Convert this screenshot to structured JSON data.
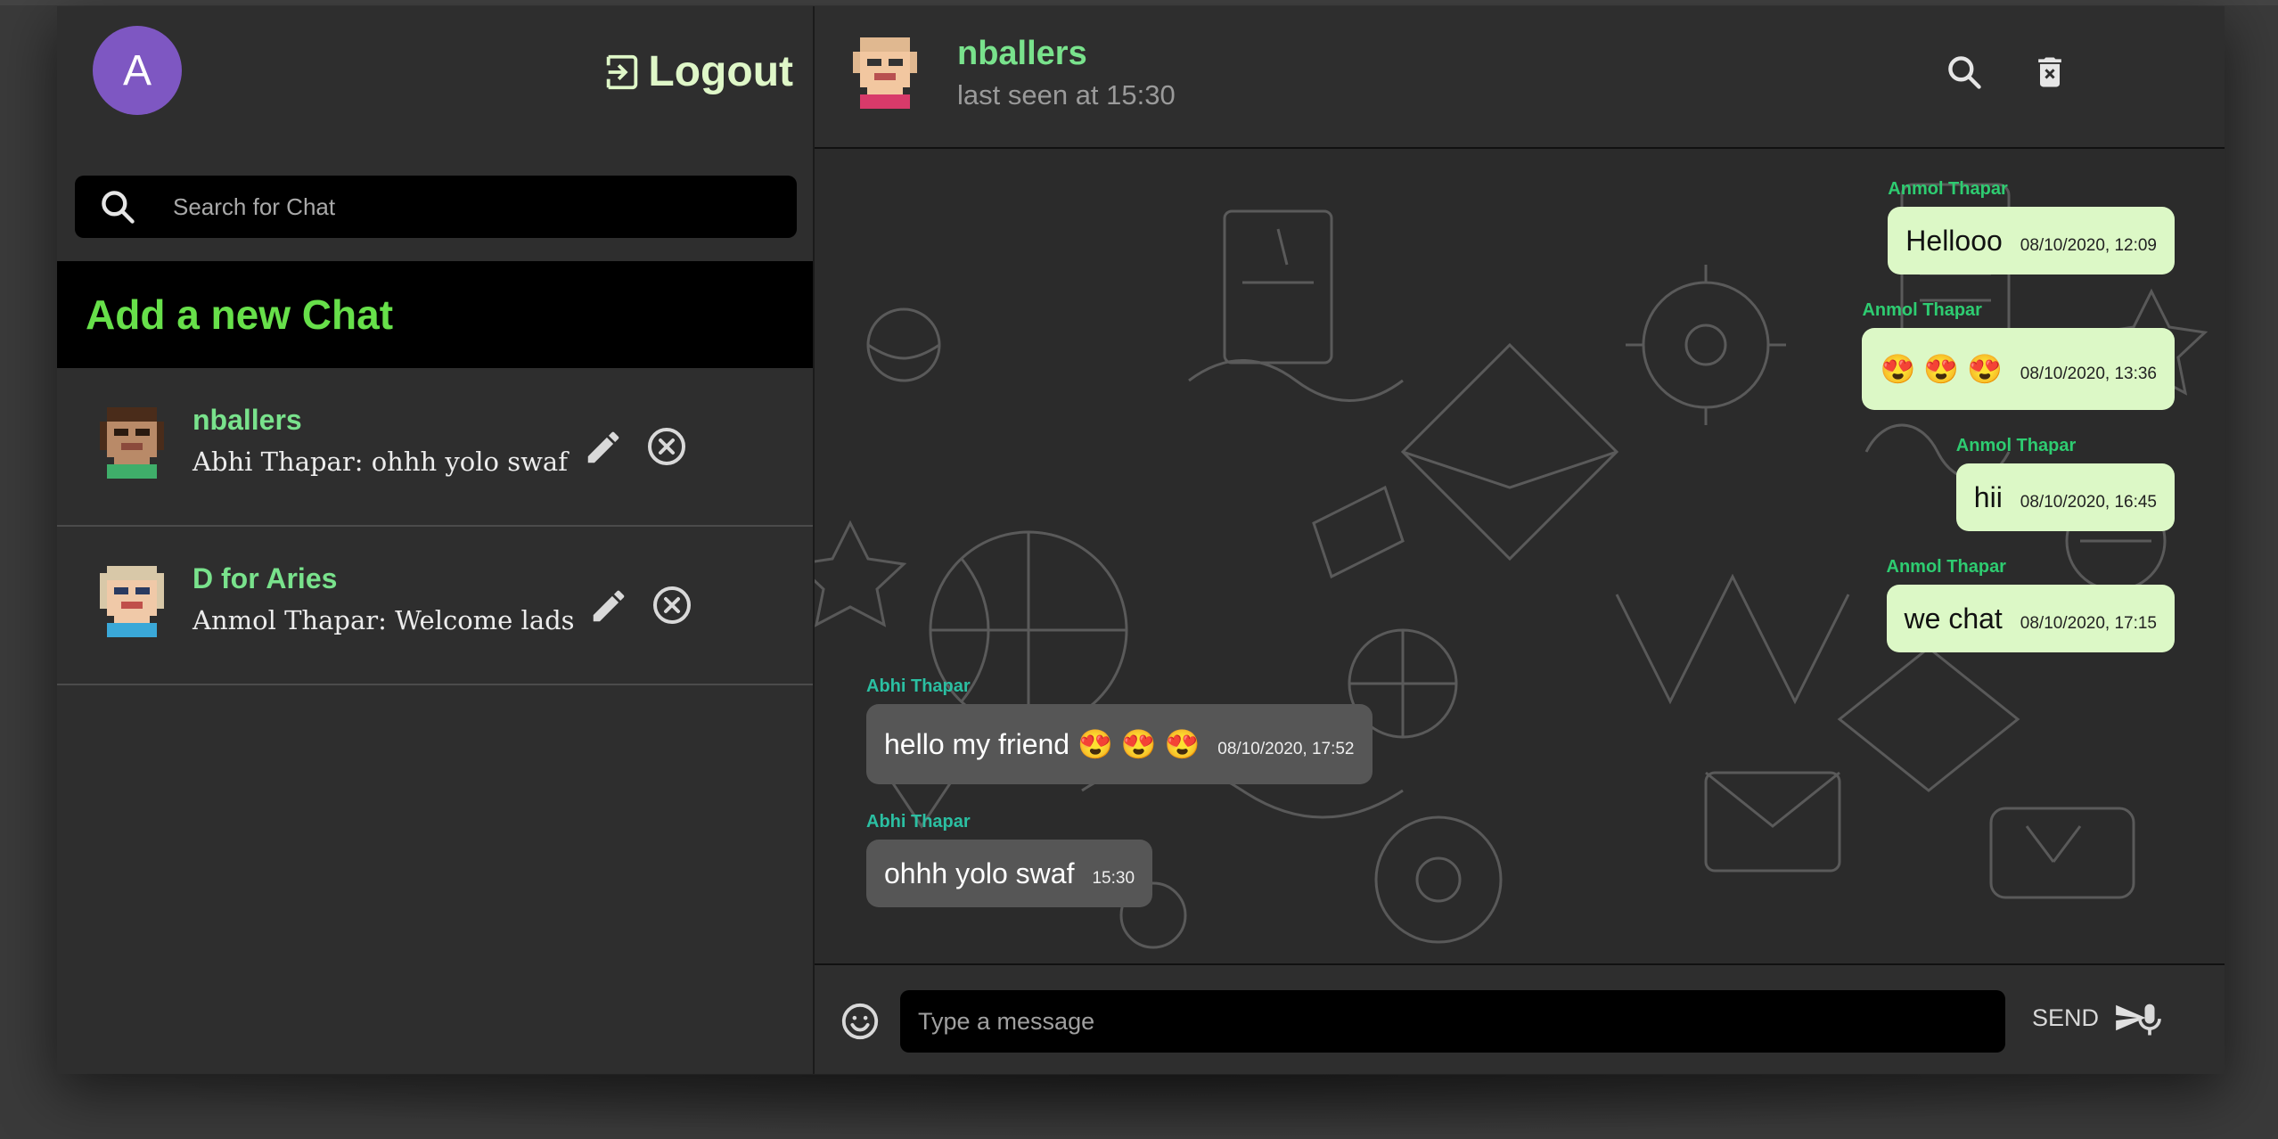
{
  "sidebar": {
    "avatar_letter": "A",
    "logout_label": "Logout",
    "search_placeholder": "Search for Chat",
    "add_chat_label": "Add a new Chat",
    "chats": [
      {
        "name": "nballers",
        "last_message": "Abhi Thapar: ohhh yolo swaf"
      },
      {
        "name": "D for Aries",
        "last_message": "Anmol Thapar: Welcome lads"
      }
    ]
  },
  "header": {
    "name": "nballers",
    "status": "last seen at 15:30"
  },
  "messages": [
    {
      "author": "Anmol Thapar",
      "text": "Hellooo",
      "time": "08/10/2020, 12:09",
      "direction": "out"
    },
    {
      "author": "Anmol Thapar",
      "text": "😍 😍 😍",
      "time": "08/10/2020, 13:36",
      "direction": "out"
    },
    {
      "author": "Anmol Thapar",
      "text": "hii",
      "time": "08/10/2020, 16:45",
      "direction": "out"
    },
    {
      "author": "Anmol Thapar",
      "text": "we chat",
      "time": "08/10/2020, 17:15",
      "direction": "out"
    },
    {
      "author": "Abhi Thapar",
      "text": "hello my friend 😍 😍 😍",
      "time": "08/10/2020, 17:52",
      "direction": "in"
    },
    {
      "author": "Abhi Thapar",
      "text": "ohhh yolo swaf",
      "time": "15:30",
      "direction": "in"
    }
  ],
  "composer": {
    "placeholder": "Type a message",
    "send_label": "SEND"
  },
  "icons": {
    "logout": "logout-icon",
    "search": "search-icon",
    "edit": "pencil-icon",
    "remove": "close-circle-icon",
    "header_search": "search-icon",
    "delete": "trash-icon",
    "emoji": "emoji-icon",
    "send": "send-icon",
    "mic": "mic-icon"
  },
  "colors": {
    "accent_green": "#79e28c",
    "add_chat_green": "#67e04a",
    "outgoing_bubble": "#dcf8c6",
    "incoming_bubble": "#565656",
    "avatar_purple": "#7e57c2"
  }
}
